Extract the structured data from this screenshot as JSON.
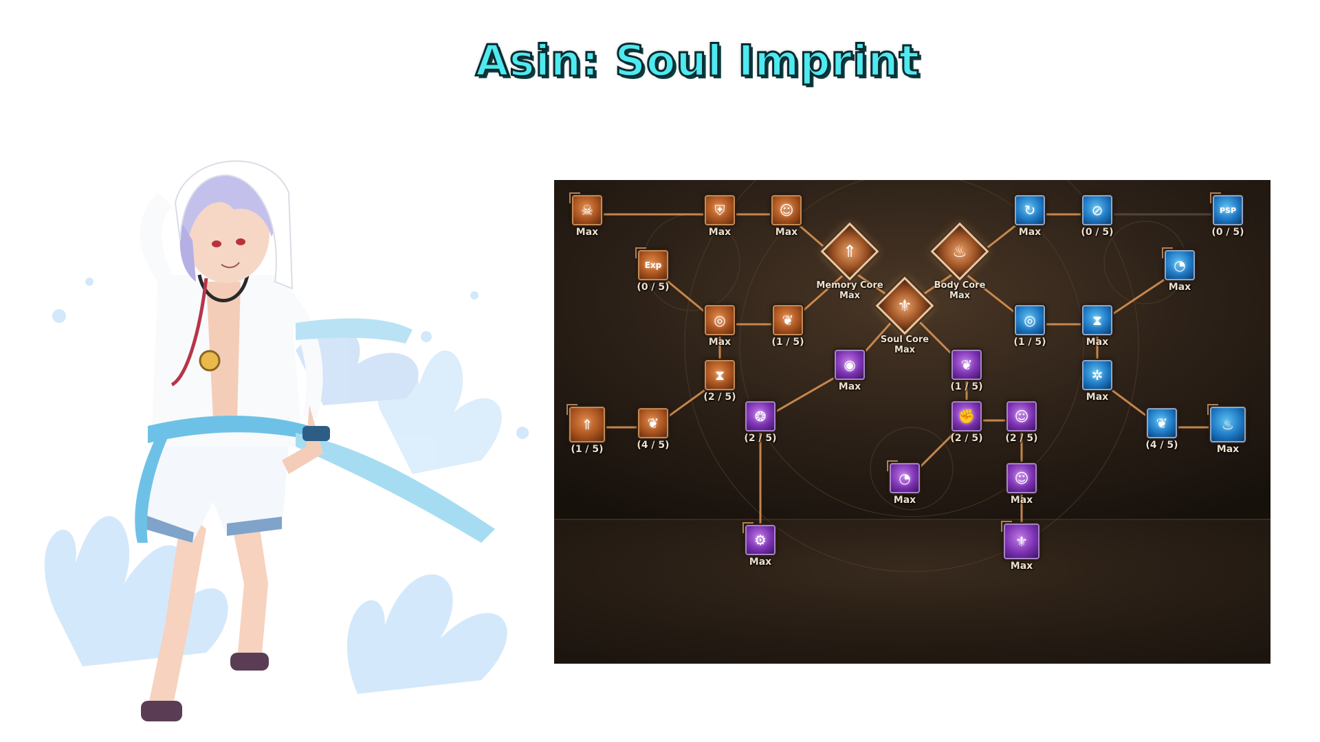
{
  "page_title": "Asin: Soul Imprint",
  "colors": {
    "title_fill": "#4fe9f0",
    "panel_bg": "#2c2118",
    "link_line": "#e5a05a",
    "orange_node": "#a9531f",
    "blue_node": "#1e78c4",
    "purple_node": "#7c32b2"
  },
  "cores": {
    "memory": {
      "name": "Memory Core",
      "level": "Max",
      "icon": "sword-icon",
      "glyph": "⇑"
    },
    "body": {
      "name": "Body Core",
      "level": "Max",
      "icon": "flame-icon",
      "glyph": "♨"
    },
    "soul": {
      "name": "Soul Core",
      "level": "Max",
      "icon": "trident-icon",
      "glyph": "⚜"
    }
  },
  "nodes": {
    "n1": {
      "level": "Max",
      "icon": "demon-mask-icon",
      "glyph": "☠"
    },
    "n2": {
      "level": "Max",
      "icon": "shield-icon",
      "glyph": "⛨"
    },
    "n3": {
      "level": "Max",
      "icon": "user-up-icon",
      "glyph": "☺"
    },
    "n4": {
      "level": "(0 / 5)",
      "icon": "exp-icon",
      "glyph": "Exp"
    },
    "n5": {
      "level": "Max",
      "icon": "target-icon",
      "glyph": "◎"
    },
    "n6": {
      "level": "(1 / 5)",
      "icon": "feather-icon",
      "glyph": "❦"
    },
    "n7": {
      "level": "(2 / 5)",
      "icon": "hourglass-icon",
      "glyph": "⧗"
    },
    "n8": {
      "level": "(1 / 5)",
      "icon": "sword-up-icon",
      "glyph": "⇑"
    },
    "n9": {
      "level": "(4 / 5)",
      "icon": "feather-icon",
      "glyph": "❦"
    },
    "n10": {
      "level": "Max",
      "icon": "orb-icon",
      "glyph": "◉"
    },
    "n11": {
      "level": "(1 / 5)",
      "icon": "feather-icon",
      "glyph": "❦"
    },
    "n12": {
      "level": "(2 / 5)",
      "icon": "web-icon",
      "glyph": "❂"
    },
    "n13": {
      "level": "(2 / 5)",
      "icon": "fist-icon",
      "glyph": "✊"
    },
    "n14": {
      "level": "(2 / 5)",
      "icon": "user-up-icon",
      "glyph": "☺"
    },
    "n15": {
      "level": "Max",
      "icon": "clock-icon",
      "glyph": "◔"
    },
    "n16": {
      "level": "Max",
      "icon": "user-up-icon",
      "glyph": "☺"
    },
    "n17": {
      "level": "Max",
      "icon": "user-gear-icon",
      "glyph": "⚙"
    },
    "n18": {
      "level": "Max",
      "icon": "trident-icon",
      "glyph": "⚜"
    },
    "n19": {
      "level": "Max",
      "icon": "recycle-icon",
      "glyph": "↻"
    },
    "n20": {
      "level": "(0 / 5)",
      "icon": "no-shield-icon",
      "glyph": "⊘"
    },
    "n21": {
      "level": "(0 / 5)",
      "icon": "psp-icon",
      "glyph": "PSP"
    },
    "n22": {
      "level": "Max",
      "icon": "clock-icon",
      "glyph": "◔"
    },
    "n23": {
      "level": "(1 / 5)",
      "icon": "target-icon",
      "glyph": "◎"
    },
    "n24": {
      "level": "Max",
      "icon": "hourglass-icon",
      "glyph": "⧗"
    },
    "n25": {
      "level": "Max",
      "icon": "crosshair-icon",
      "glyph": "✲"
    },
    "n26": {
      "level": "(4 / 5)",
      "icon": "feather-icon",
      "glyph": "❦"
    },
    "n27": {
      "level": "Max",
      "icon": "flame-icon",
      "glyph": "♨"
    }
  }
}
